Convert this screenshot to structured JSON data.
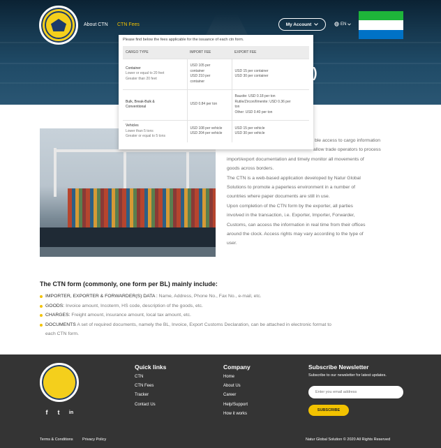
{
  "header": {
    "nav": [
      "About CTN",
      "CTN Fees"
    ],
    "account_label": "My Account",
    "lang": "EN",
    "hero_partial_text": ")",
    "flag_colors": [
      "#1eb53a",
      "#ffffff",
      "#0072c6"
    ]
  },
  "fees": {
    "intro": "Please find below the fees applicable for the issuance of each ctn form.",
    "headers": [
      "CARGO TYPE",
      "IMPORT FEE",
      "EXPORT FEE"
    ],
    "rows": [
      {
        "name": "Container",
        "sub": [
          "Lower or equal to 20 feet",
          "Greater than 20 feet"
        ],
        "import": [
          "USD 105 per",
          "container",
          "USD 210 per",
          "container"
        ],
        "export": [
          "USD 15 per container",
          "USD 30 per container"
        ]
      },
      {
        "name": "Bulk, Break-Bulk &",
        "sub_name": "Conventional",
        "sub": [],
        "import": [
          "USD 0.84 per ton"
        ],
        "export": [
          "Bauxite: USD 0.18 per ton",
          "Rutile/Zircon/Ilmenite: USD 0.36 per",
          "ton",
          "Other: USD 0.40 per ton"
        ]
      },
      {
        "name": "Vehicles",
        "sub": [
          "Lower than 5 tons",
          "Greater or equal to 5 tons"
        ],
        "import": [
          "USD 108 per vehicle",
          "USD 204 per vehicle"
        ],
        "export": [
          "USD 15 per vehicle",
          "USD 30 per vehicle"
        ]
      }
    ]
  },
  "intro_text": [
    "ble access to cargo information",
    "allow trade operators to process",
    "import/export documentation and timely monitor all movements of",
    "goods across borders.",
    "The CTN is a web-based application developed by Natur Global",
    "Solutions to promote a paperless environment in a number of",
    "countries where paper documents are still in use.",
    "Upon completion of the CTN form by the exporter, all parties",
    "involved in the transaction, i.e. Exporter, Importer, Forwarder,",
    "Customs, can access the information in real time from their offices",
    "around the clock. Access rights may vary according to the type of",
    "user."
  ],
  "form_section": {
    "title": "The CTN form (commonly, one form per BL) mainly include:",
    "items": [
      {
        "key": "IMPORTER, EXPORTER & FORWARDER(S) DATA :",
        "text": " Name, Address, Phone No., Fax No., e-mail, etc."
      },
      {
        "key": "GOODS:",
        "text": " Invoice amount, Incoterm, HS code, description of the goods, etc."
      },
      {
        "key": "CHARGES:",
        "text": " Freight amount, insurance amount, local tax amount, etc."
      },
      {
        "key": "DOCUMENTS",
        "text": " A set of required documents, namely the BL, Invoice, Export Customs Declaration, can be attached in electronic format to"
      },
      {
        "key": "",
        "text": "each CTN form."
      }
    ]
  },
  "footer": {
    "quick_links_title": "Quick links",
    "quick_links": [
      "CTN",
      "CTN Fees",
      "Tracker",
      "Contact Us"
    ],
    "company_title": "Company",
    "company_links": [
      "Home",
      "About Us",
      "Career",
      "Help/Support",
      "How it works"
    ],
    "newsletter_title": "Subscribe Newsletter",
    "newsletter_text": "Subscribe to our newsletter for latest updates.",
    "email_placeholder": "Enter you email address",
    "subscribe_label": "SUBSCRIBE",
    "social": [
      "f",
      "t",
      "in"
    ],
    "terms": "Terms & Conditions",
    "privacy": "Privacy Policy",
    "copyright": "Natur Global Solution © 2020 All Rights Reserved"
  }
}
